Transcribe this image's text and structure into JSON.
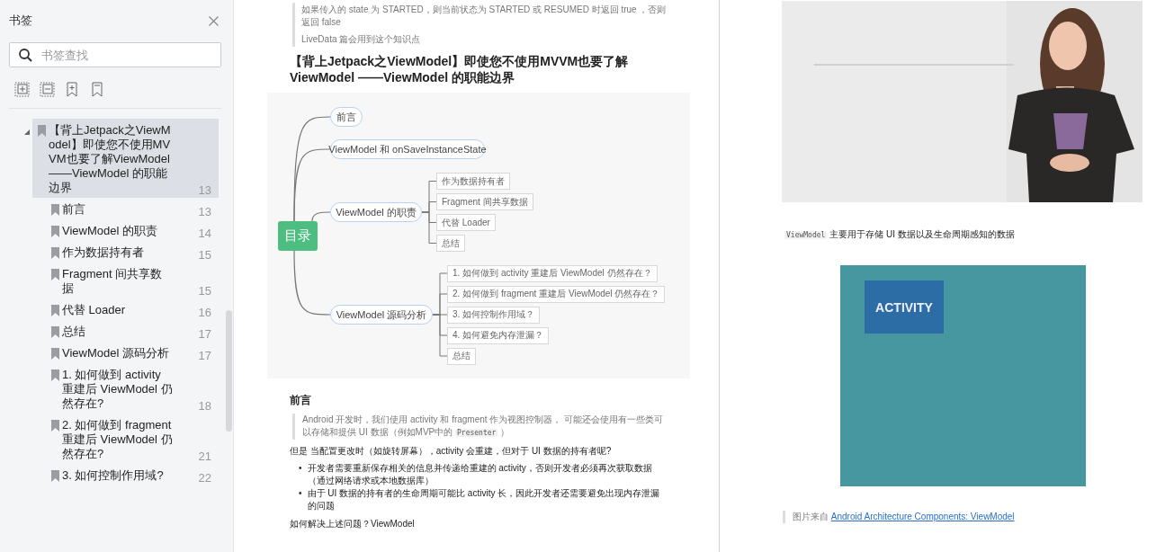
{
  "sidebar": {
    "title": "书签",
    "search": {
      "placeholder": "书签查找"
    },
    "bookmarks": [
      {
        "title": "【背上Jetpack之ViewModel】即使您不使用MVVM也要了解ViewModel ——ViewModel 的职能边界",
        "page": "13",
        "selected": true,
        "expanded": true,
        "children": [
          {
            "title": "前言",
            "page": "13",
            "selected": false
          },
          {
            "title": "ViewModel 的职责",
            "page": "14",
            "selected": false
          },
          {
            "title": "作为数据持有者",
            "page": "15",
            "selected": false
          },
          {
            "title": "Fragment 间共享数据",
            "page": "15",
            "selected": false
          },
          {
            "title": "代替 Loader",
            "page": "16",
            "selected": false
          },
          {
            "title": "总结",
            "page": "17",
            "selected": false
          },
          {
            "title": "ViewModel 源码分析",
            "page": "17",
            "selected": false
          },
          {
            "title": "1. 如何做到 activity 重建后 ViewModel 仍然存在?",
            "page": "18",
            "selected": false
          },
          {
            "title": "2. 如何做到 fragment 重建后 ViewModel 仍然存在?",
            "page": "21",
            "selected": false
          },
          {
            "title": "3. 如何控制作用域?",
            "page": "22",
            "selected": false
          }
        ]
      }
    ]
  },
  "left_page": {
    "note": [
      "如果传入的 state 为 STARTED，则当前状态为 STARTED 或 RESUMED 时返回 true ，否则返回 false",
      "LiveData 篇会用到这个知识点"
    ],
    "heading": "【背上Jetpack之ViewModel】即使您不使用MVVM也要了解ViewModel ——ViewModel 的职能边界",
    "mindmap": {
      "root": "目录",
      "branches": [
        {
          "label": "前言"
        },
        {
          "label": "ViewModel 和 onSaveInstanceState"
        },
        {
          "label": "ViewModel 的职责",
          "children": [
            "作为数据持有者",
            "Fragment 间共享数据",
            "代替 Loader",
            "总结"
          ]
        },
        {
          "label": "ViewModel 源码分析",
          "children": [
            "1. 如何做到 activity 重建后 ViewModel 仍然存在？",
            "2. 如何做到 fragment 重建后 ViewModel 仍然存在？",
            "3. 如何控制作用域？",
            "4. 如何避免内存泄漏？",
            "总结"
          ]
        }
      ]
    },
    "section_title": "前言",
    "quote": [
      {
        "kind": "text",
        "text": "Android 开发时，我们使用 activity 和 fragment 作为视图控制器， 可能还会使用有一些类可以存储和提供 UI 数据（例如MVP中的 "
      },
      {
        "kind": "code",
        "text": "Presenter"
      },
      {
        "kind": "text",
        "text": " ）"
      }
    ],
    "question": "但是 当配置更改时（如旋转屏幕），activity 会重建，但对于 UI 数据的持有者呢?",
    "bullets": [
      {
        "marker": "•",
        "text": "开发者需要重新保存相关的信息并传递给重建的 activity，否则开发者必须再次获取数据（通过网络请求或本地数据库）"
      },
      {
        "marker": "•",
        "text": "由于 UI 数据的持有者的生命周期可能比 activity 长，因此开发者还需要避免出现内存泄漏的问题"
      }
    ],
    "answer": "如何解决上述问题？ViewModel"
  },
  "right_page": {
    "intro": [
      {
        "kind": "code",
        "text": "ViewModel"
      },
      {
        "kind": "text",
        "text": " 主要用于存储 UI 数据以及生命周期感知的数据"
      }
    ],
    "diagram": {
      "label": "ACTIVITY"
    },
    "caption": {
      "text": "图片来自 ",
      "link": "Android Architecture Components: ViewModel"
    }
  }
}
